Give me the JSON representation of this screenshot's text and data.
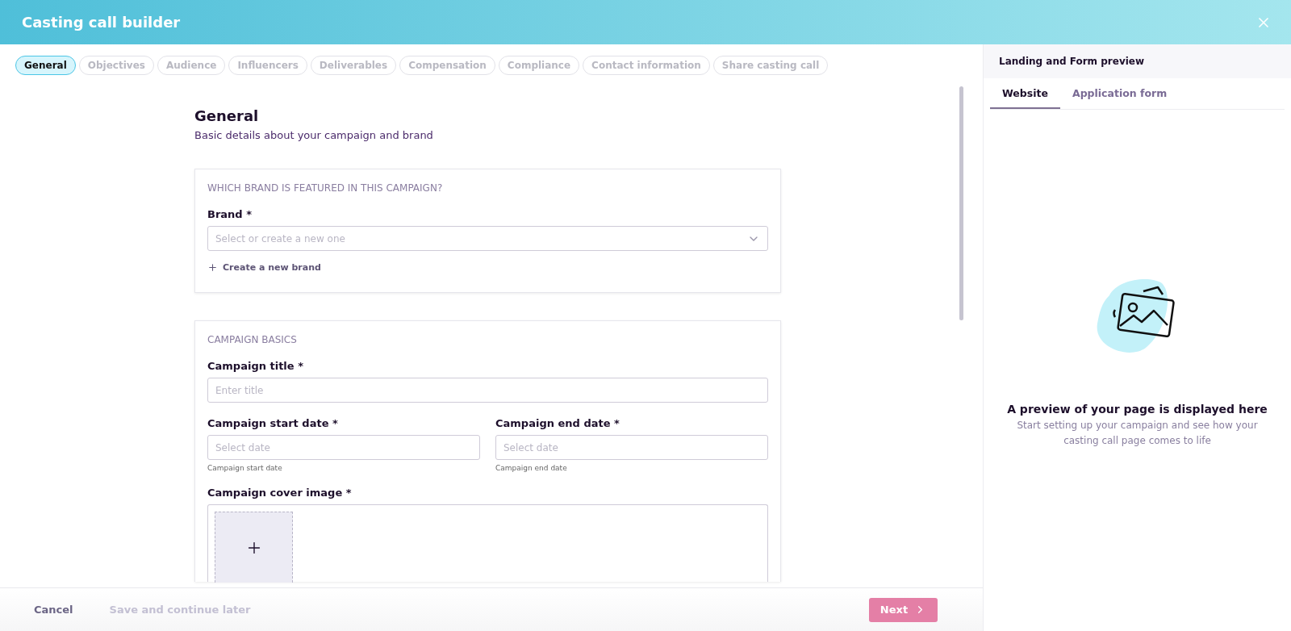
{
  "header": {
    "title": "Casting call builder"
  },
  "steps": [
    {
      "label": "General",
      "selected": true
    },
    {
      "label": "Objectives",
      "selected": false
    },
    {
      "label": "Audience",
      "selected": false
    },
    {
      "label": "Influencers",
      "selected": false
    },
    {
      "label": "Deliverables",
      "selected": false
    },
    {
      "label": "Compensation",
      "selected": false
    },
    {
      "label": "Compliance",
      "selected": false
    },
    {
      "label": "Contact information",
      "selected": false
    },
    {
      "label": "Share casting call",
      "selected": false
    }
  ],
  "section": {
    "title": "General",
    "subtitle": "Basic details about your campaign and brand"
  },
  "brand_card": {
    "heading": "WHICH BRAND IS FEATURED IN THIS CAMPAIGN?",
    "label": "Brand *",
    "placeholder": "Select or create a new one",
    "create_link": "Create a new brand"
  },
  "basics_card": {
    "heading": "CAMPAIGN BASICS",
    "title_label": "Campaign title *",
    "title_placeholder": "Enter title",
    "dates": [
      {
        "label": "Campaign start date *",
        "placeholder": "Select date",
        "hint": "Campaign start date"
      },
      {
        "label": "Campaign end date *",
        "placeholder": "Select date",
        "hint": "Campaign end date"
      }
    ],
    "cover_label": "Campaign cover image *"
  },
  "footer": {
    "cancel": "Cancel",
    "save": {
      "label": "Save and continue later",
      "disabled": true
    },
    "next": {
      "label": "Next",
      "disabled": true
    }
  },
  "preview": {
    "title": "Landing and Form preview",
    "tabs": [
      {
        "label": "Website",
        "selected": true
      },
      {
        "label": "Application form",
        "selected": false
      }
    ],
    "empty_title": "A preview of your page is displayed here",
    "empty_text": "Start setting up your campaign and see how your casting call page comes to life"
  }
}
